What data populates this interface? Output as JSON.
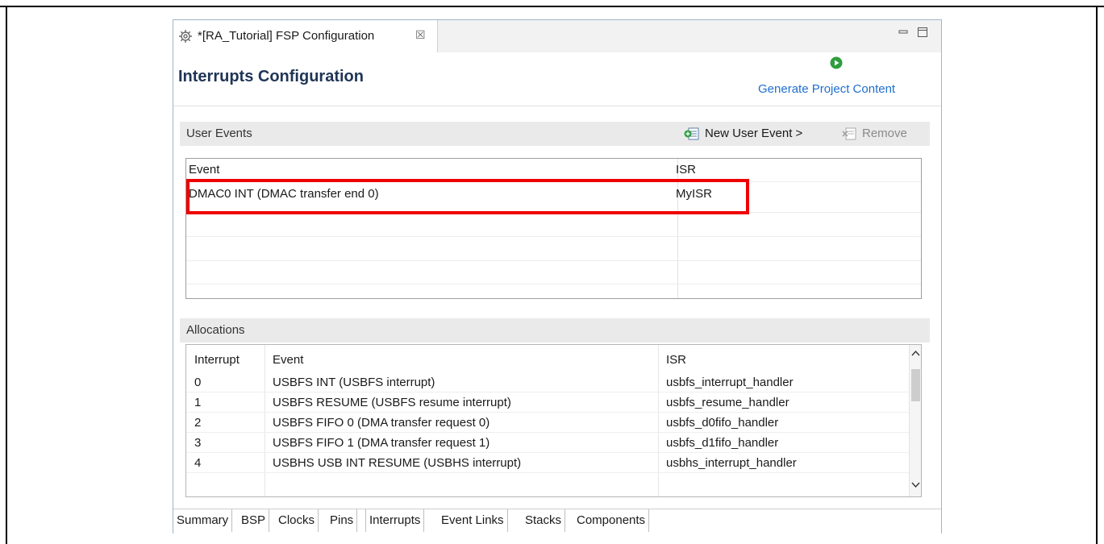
{
  "window": {
    "tab_title": "*[RA_Tutorial] FSP Configuration",
    "tab_close_glyph": "☒",
    "icons": {
      "tab": "gear-icon",
      "close": "close-icon",
      "minimize": "minimize-icon",
      "maximize": "maximize-icon"
    }
  },
  "header": {
    "title": "Interrupts Configuration",
    "generate_label": "Generate Project Content",
    "generate_icon": "play-circle-icon",
    "accent_color": "#1f6fd1",
    "generate_icon_color": "#2e9e3e"
  },
  "user_events": {
    "section_title": "User Events",
    "new_label": "New User Event >",
    "remove_label": "Remove",
    "columns": [
      "Event",
      "ISR"
    ],
    "rows": [
      {
        "event": "DMAC0 INT (DMAC transfer end 0)",
        "isr": "MyISR"
      }
    ],
    "highlight_color": "#ee0000"
  },
  "allocations": {
    "section_title": "Allocations",
    "columns": [
      "Interrupt",
      "Event",
      "ISR"
    ],
    "rows": [
      {
        "interrupt": "0",
        "event": "USBFS INT (USBFS interrupt)",
        "isr": "usbfs_interrupt_handler"
      },
      {
        "interrupt": "1",
        "event": "USBFS RESUME (USBFS resume interrupt)",
        "isr": "usbfs_resume_handler"
      },
      {
        "interrupt": "2",
        "event": "USBFS FIFO 0 (DMA transfer request 0)",
        "isr": "usbfs_d0fifo_handler"
      },
      {
        "interrupt": "3",
        "event": "USBFS FIFO 1 (DMA transfer request 1)",
        "isr": "usbfs_d1fifo_handler"
      },
      {
        "interrupt": "4",
        "event": "USBHS USB INT RESUME (USBHS interrupt)",
        "isr": "usbhs_interrupt_handler"
      }
    ]
  },
  "bottom_tabs": [
    "Summary",
    "BSP",
    "Clocks",
    "Pins",
    "Interrupts",
    "Event Links",
    "Stacks",
    "Components"
  ],
  "active_tab": "Interrupts"
}
